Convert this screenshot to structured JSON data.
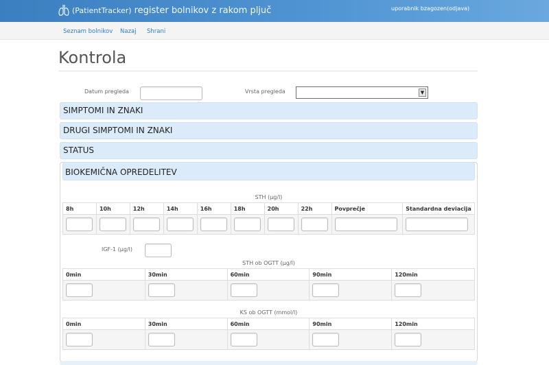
{
  "header": {
    "brand_prefix": "(PatientTracker)",
    "brand_title": "register bolnikov z rakom pljuč",
    "user_label": "uporabnik bzagozen",
    "logout_label": "(odjava)"
  },
  "nav": {
    "items": [
      {
        "label": "Seznam bolnikov"
      },
      {
        "label": "Nazaj"
      },
      {
        "label": "Shrani"
      }
    ]
  },
  "page": {
    "title": "Kontrola"
  },
  "form": {
    "date_label": "Datum pregleda",
    "date_value": "",
    "type_label": "Vrsta pregleda",
    "type_value": ""
  },
  "sections": [
    {
      "label": "SIMPTOMI IN ZNAKI"
    },
    {
      "label": "DRUGI SIMPTOMI IN ZNAKI"
    },
    {
      "label": "STATUS"
    },
    {
      "label": "BIOKEMIČNA OPREDELITEV"
    }
  ],
  "biochem": {
    "sth": {
      "caption": "STH (µg/l)",
      "columns": [
        "8h",
        "10h",
        "12h",
        "14h",
        "16h",
        "18h",
        "20h",
        "22h",
        "Povprečje",
        "Standardna deviacija"
      ]
    },
    "igf": {
      "label": "IGF-1 (µg/l)",
      "value": ""
    },
    "sth_ogtt": {
      "caption": "STH ob OGTT (µg/l)",
      "columns": [
        "0min",
        "30min",
        "60min",
        "90min",
        "120min"
      ]
    },
    "ks_ogtt": {
      "caption": "KS ob OGTT (mmol/l)",
      "columns": [
        "0min",
        "30min",
        "60min",
        "90min",
        "120min"
      ]
    }
  }
}
